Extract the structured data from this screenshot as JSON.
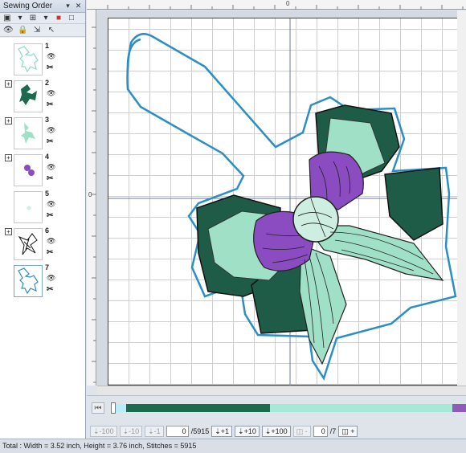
{
  "panel": {
    "title": "Sewing Order",
    "items": [
      {
        "num": "1",
        "expandable": false
      },
      {
        "num": "2",
        "expandable": true
      },
      {
        "num": "3",
        "expandable": true
      },
      {
        "num": "4",
        "expandable": true
      },
      {
        "num": "5",
        "expandable": false
      },
      {
        "num": "6",
        "expandable": true
      },
      {
        "num": "7",
        "expandable": false
      }
    ]
  },
  "ruler": {
    "mark": "0"
  },
  "player": {
    "buttons": [
      "-100",
      "-10",
      "-1",
      "+1",
      "+10",
      "+100"
    ],
    "stitch_value": "0",
    "stitch_total": "/5915",
    "color_value": "0",
    "color_total": "/7",
    "segments": [
      {
        "color": "#b8ecf6",
        "share": 0.03
      },
      {
        "color": "#1c6b4e",
        "share": 0.41
      },
      {
        "color": "#a8e8d6",
        "share": 0.52
      },
      {
        "color": "#8e5bb8",
        "share": 0.04
      }
    ]
  },
  "colors": {
    "outline": "#2a8fc4",
    "dark_green": "#1f5c47",
    "mint": "#9fe0c7",
    "purple": "#8a4cc0",
    "light_mint": "#cdeee1"
  },
  "status": {
    "text": "Total : Width = 3.52 inch, Height = 3.76 inch, Stitches = 5915"
  }
}
